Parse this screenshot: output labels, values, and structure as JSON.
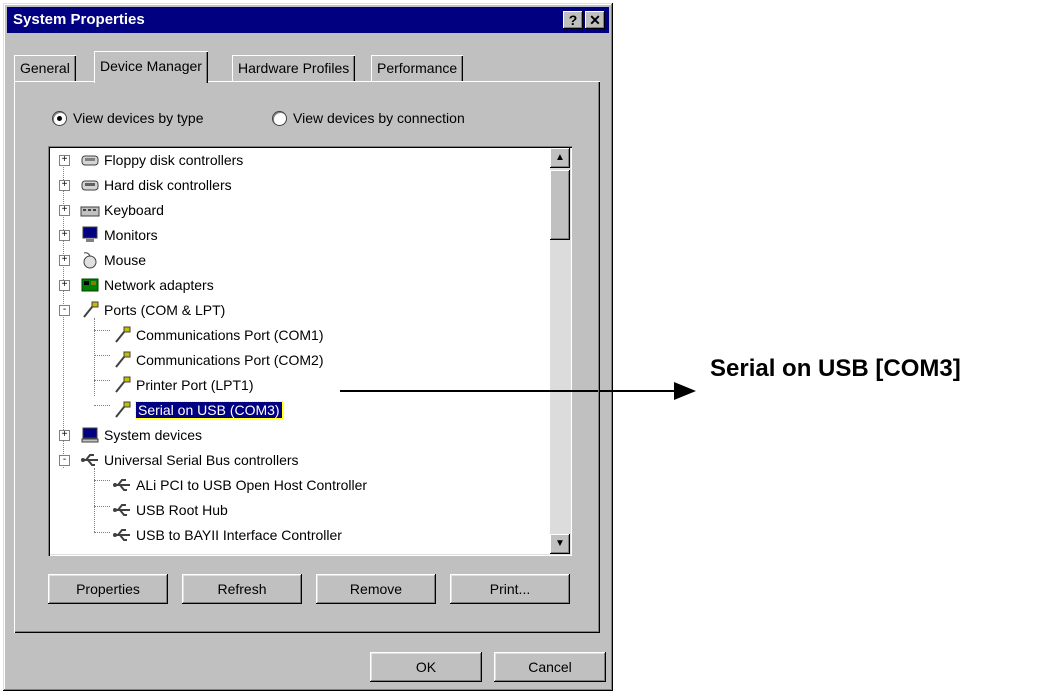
{
  "window": {
    "title": "System Properties",
    "help_button": "?",
    "close_button": "✕"
  },
  "tabs": [
    {
      "label": "General",
      "active": false
    },
    {
      "label": "Device Manager",
      "active": true
    },
    {
      "label": "Hardware Profiles",
      "active": false
    },
    {
      "label": "Performance",
      "active": false
    }
  ],
  "view_options": {
    "by_type": {
      "label": "View devices by type",
      "selected": true
    },
    "by_connection": {
      "label": "View devices by connection",
      "selected": false
    }
  },
  "tree": {
    "items": [
      {
        "label": "Floppy disk controllers",
        "icon": "floppy-controller-icon",
        "level": 0,
        "expander": "+"
      },
      {
        "label": "Hard disk controllers",
        "icon": "hard-disk-controller-icon",
        "level": 0,
        "expander": "+"
      },
      {
        "label": "Keyboard",
        "icon": "keyboard-icon",
        "level": 0,
        "expander": "+"
      },
      {
        "label": "Monitors",
        "icon": "monitor-icon",
        "level": 0,
        "expander": "+"
      },
      {
        "label": "Mouse",
        "icon": "mouse-icon",
        "level": 0,
        "expander": "+"
      },
      {
        "label": "Network adapters",
        "icon": "network-adapter-icon",
        "level": 0,
        "expander": "+"
      },
      {
        "label": "Ports (COM & LPT)",
        "icon": "port-icon",
        "level": 0,
        "expander": "-"
      },
      {
        "label": "Communications Port (COM1)",
        "icon": "port-icon",
        "level": 1
      },
      {
        "label": "Communications Port (COM2)",
        "icon": "port-icon",
        "level": 1
      },
      {
        "label": "Printer Port (LPT1)",
        "icon": "port-icon",
        "level": 1
      },
      {
        "label": "Serial on USB (COM3)",
        "icon": "port-icon",
        "level": 1,
        "selected": true
      },
      {
        "label": "System devices",
        "icon": "system-device-icon",
        "level": 0,
        "expander": "+"
      },
      {
        "label": "Universal Serial Bus controllers",
        "icon": "usb-icon",
        "level": 0,
        "expander": "-"
      },
      {
        "label": "ALi PCI to USB Open Host Controller",
        "icon": "usb-icon",
        "level": 1
      },
      {
        "label": "USB Root Hub",
        "icon": "usb-icon",
        "level": 1
      },
      {
        "label": "USB to BAYII Interface Controller",
        "icon": "usb-icon",
        "level": 1
      }
    ]
  },
  "scrollbar": {
    "up": "▲",
    "down": "▼"
  },
  "buttons": {
    "properties": "Properties",
    "refresh": "Refresh",
    "remove": "Remove",
    "print": "Print...",
    "ok": "OK",
    "cancel": "Cancel"
  },
  "annotation": {
    "text": "Serial on USB [COM3]"
  },
  "colors": {
    "titlebar": "#000080",
    "dialog_bg": "#c0c0c0",
    "selection": "#000080"
  }
}
